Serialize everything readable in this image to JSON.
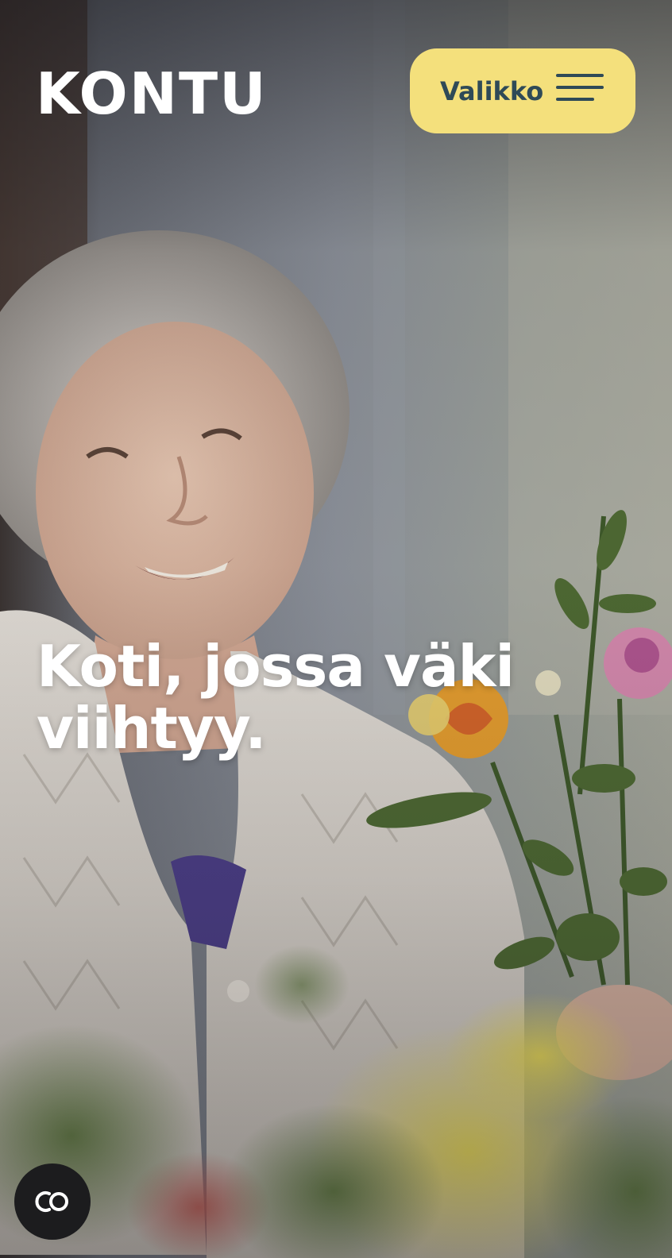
{
  "header": {
    "logo_text": "KONTU",
    "menu_label": "Valikko",
    "menu_icon": "hamburger-icon"
  },
  "hero": {
    "headline": "Koti, jossa väki viihtyy.",
    "image_alt": "Hymyilevä iäkäs nainen kukkakimpun kanssa"
  },
  "cookie_button": {
    "icon": "cookie-settings-icon"
  },
  "colors": {
    "accent": "#f4e07c",
    "brand_dark": "#2f4a57",
    "text_light": "#ffffff",
    "cookie_bg": "#1c1c1e"
  }
}
